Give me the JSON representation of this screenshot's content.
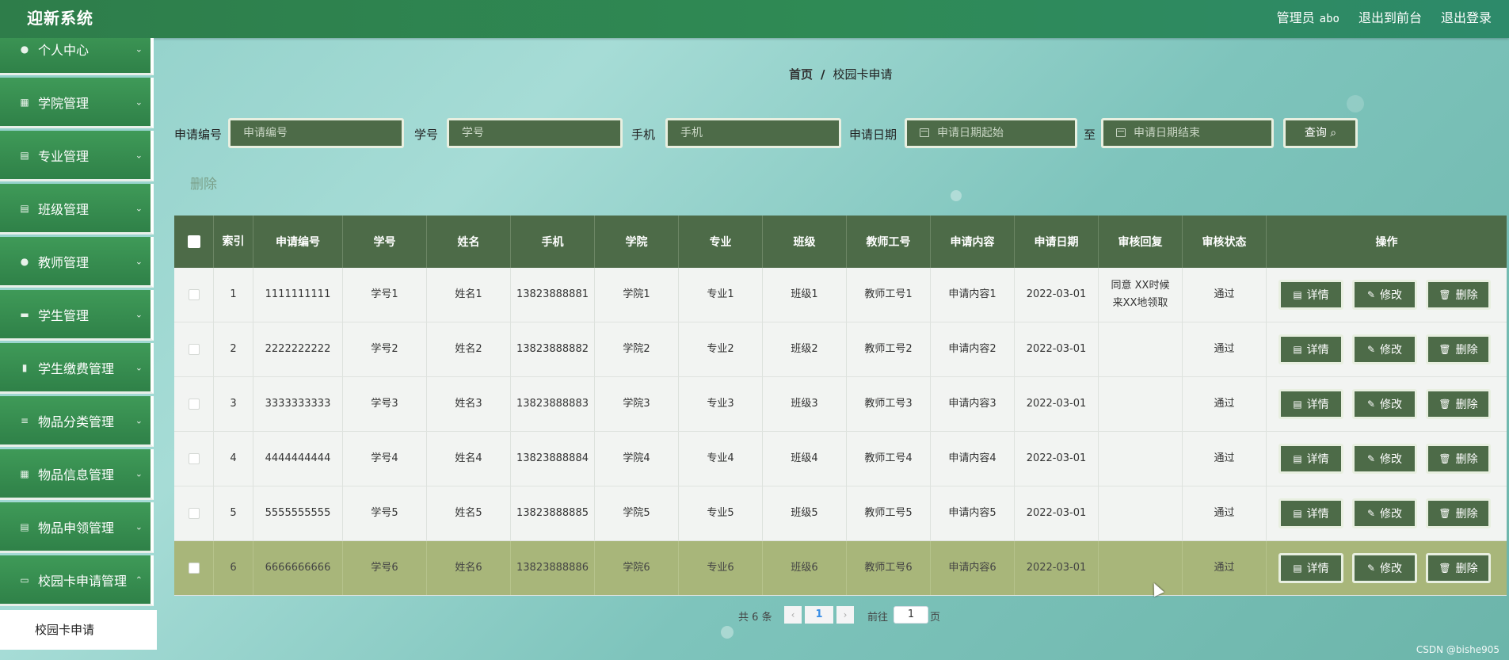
{
  "app": {
    "title": "迎新系统"
  },
  "header": {
    "user_label": "管理员",
    "username": "abo",
    "front_link": "退出到前台",
    "logout_link": "退出登录"
  },
  "sidebar": {
    "items": [
      {
        "label": "个人中心",
        "icon": "user-icon"
      },
      {
        "label": "学院管理",
        "icon": "grid-icon"
      },
      {
        "label": "专业管理",
        "icon": "clipboard-icon"
      },
      {
        "label": "班级管理",
        "icon": "clipboard-icon"
      },
      {
        "label": "教师管理",
        "icon": "user-icon"
      },
      {
        "label": "学生管理",
        "icon": "chat-icon"
      },
      {
        "label": "学生缴费管理",
        "icon": "bar-chart-icon"
      },
      {
        "label": "物品分类管理",
        "icon": "list-icon"
      },
      {
        "label": "物品信息管理",
        "icon": "grid-icon"
      },
      {
        "label": "物品申领管理",
        "icon": "clipboard-icon"
      },
      {
        "label": "校园卡申请管理",
        "icon": "card-icon"
      }
    ],
    "active_sub": "校园卡申请"
  },
  "breadcrumb": {
    "home": "首页",
    "sep": "/",
    "current": "校园卡申请"
  },
  "search": {
    "apply_no_label": "申请编号",
    "apply_no_placeholder": "申请编号",
    "student_no_label": "学号",
    "student_no_placeholder": "学号",
    "phone_label": "手机",
    "phone_placeholder": "手机",
    "date_label": "申请日期",
    "date_start_placeholder": "申请日期起始",
    "to_label": "至",
    "date_end_placeholder": "申请日期结束",
    "query_button": "查询"
  },
  "bulk_delete": "删除",
  "table": {
    "headers": [
      "索引",
      "申请编号",
      "学号",
      "姓名",
      "手机",
      "学院",
      "专业",
      "班级",
      "教师工号",
      "申请内容",
      "申请日期",
      "审核回复",
      "审核状态",
      "操作"
    ],
    "rows": [
      {
        "index": "1",
        "apply_no": "1111111111",
        "student_no": "学号1",
        "name": "姓名1",
        "phone": "13823888881",
        "college": "学院1",
        "major": "专业1",
        "class": "班级1",
        "teacher_no": "教师工号1",
        "content": "申请内容1",
        "date": "2022-03-01",
        "reply": "同意 XX时候来XX地领取",
        "status": "通过"
      },
      {
        "index": "2",
        "apply_no": "2222222222",
        "student_no": "学号2",
        "name": "姓名2",
        "phone": "13823888882",
        "college": "学院2",
        "major": "专业2",
        "class": "班级2",
        "teacher_no": "教师工号2",
        "content": "申请内容2",
        "date": "2022-03-01",
        "reply": "",
        "status": "通过"
      },
      {
        "index": "3",
        "apply_no": "3333333333",
        "student_no": "学号3",
        "name": "姓名3",
        "phone": "13823888883",
        "college": "学院3",
        "major": "专业3",
        "class": "班级3",
        "teacher_no": "教师工号3",
        "content": "申请内容3",
        "date": "2022-03-01",
        "reply": "",
        "status": "通过"
      },
      {
        "index": "4",
        "apply_no": "4444444444",
        "student_no": "学号4",
        "name": "姓名4",
        "phone": "13823888884",
        "college": "学院4",
        "major": "专业4",
        "class": "班级4",
        "teacher_no": "教师工号4",
        "content": "申请内容4",
        "date": "2022-03-01",
        "reply": "",
        "status": "通过"
      },
      {
        "index": "5",
        "apply_no": "5555555555",
        "student_no": "学号5",
        "name": "姓名5",
        "phone": "13823888885",
        "college": "学院5",
        "major": "专业5",
        "class": "班级5",
        "teacher_no": "教师工号5",
        "content": "申请内容5",
        "date": "2022-03-01",
        "reply": "",
        "status": "通过"
      },
      {
        "index": "6",
        "apply_no": "6666666666",
        "student_no": "学号6",
        "name": "姓名6",
        "phone": "13823888886",
        "college": "学院6",
        "major": "专业6",
        "class": "班级6",
        "teacher_no": "教师工号6",
        "content": "申请内容6",
        "date": "2022-03-01",
        "reply": "",
        "status": "通过"
      }
    ],
    "actions": {
      "detail": "详情",
      "edit": "修改",
      "delete": "删除"
    }
  },
  "pagination": {
    "total_prefix": "共",
    "total": "6",
    "total_suffix": "条",
    "prev": "‹",
    "page": "1",
    "next": "›",
    "goto_prefix": "前往",
    "goto_value": "1",
    "goto_suffix": "页"
  },
  "watermark": "CSDN @bishe905",
  "colors": {
    "header": "#2e7d4a",
    "sidebar": "#3a8f52",
    "table_head": "#4d6b48",
    "highlight_row": "#a8b67a",
    "input_bg": "#4d6b48"
  }
}
